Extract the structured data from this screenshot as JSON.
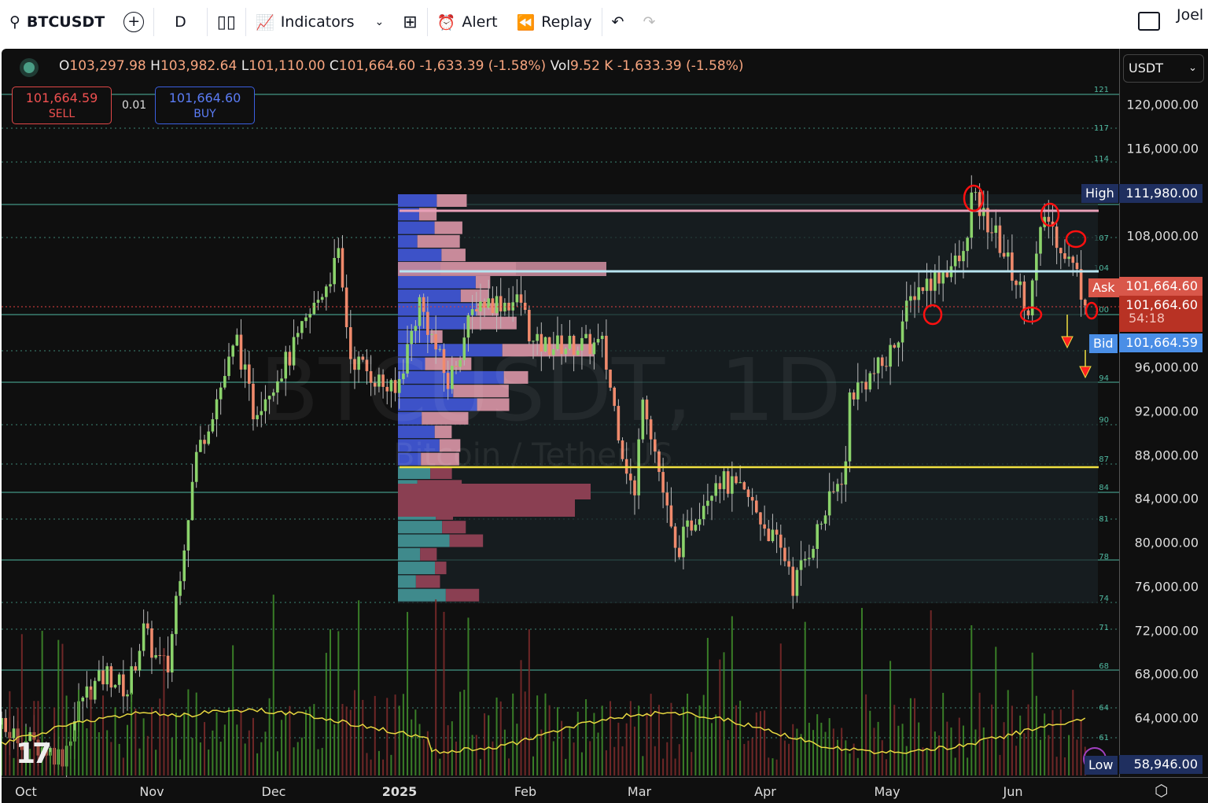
{
  "toolbar": {
    "symbol": "BTCUSDT",
    "interval": "D",
    "indicators": "Indicators",
    "alert": "Alert",
    "replay": "Replay",
    "user": "Joel"
  },
  "legend": {
    "o_label": "O",
    "o": "103,297.98",
    "h_label": "H",
    "h": "103,982.64",
    "l_label": "L",
    "l": "101,110.00",
    "c_label": "C",
    "c": "101,664.60",
    "change": "-1,633.39 (-1.58%)",
    "vol_label": "Vol",
    "vol": "9.52 K",
    "change2": "-1,633.39 (-1.58%)"
  },
  "trade": {
    "sell_price": "101,664.59",
    "sell_label": "SELL",
    "qty": "0.01",
    "buy_price": "101,664.60",
    "buy_label": "BUY"
  },
  "watermark": {
    "title": "BTCUSDT, 1D",
    "subtitle": "Bitcoin / TetherUS"
  },
  "price_axis": {
    "currency": "USDT",
    "labels": [
      "120,000.00",
      "116,000.00",
      "108,000.00",
      "96,000.00",
      "92,000.00",
      "88,000.00",
      "84,000.00",
      "80,000.00",
      "76,000.00",
      "72,000.00",
      "68,000.00",
      "64,000.00"
    ],
    "high_label": "High",
    "high": "111,980.00",
    "ask_label": "Ask",
    "ask": "101,664.60",
    "last": "101,664.60",
    "countdown": "54:18",
    "bid_label": "Bid",
    "bid": "101,664.59",
    "low_label": "Low",
    "low": "58,946.00"
  },
  "level_labels": [
    "121",
    "117",
    "114",
    "107",
    "104",
    "100",
    "94",
    "90",
    "87",
    "84",
    "81",
    "78",
    "74",
    "71",
    "68",
    "64",
    "61"
  ],
  "time_axis": [
    "Oct",
    "Nov",
    "Dec",
    "2025",
    "Feb",
    "Mar",
    "Apr",
    "May",
    "Jun"
  ],
  "colors": {
    "up": "#8bd36b",
    "down": "#f08a6c",
    "ma": "#e8d840",
    "level": "#4fb8a0"
  },
  "chart_data": {
    "type": "candlestick",
    "keypoints_day_price": [
      [
        -6,
        63000
      ],
      [
        0,
        62000
      ],
      [
        9,
        60500
      ],
      [
        14,
        66000
      ],
      [
        20,
        68000
      ],
      [
        25,
        66500
      ],
      [
        29,
        72000
      ],
      [
        32,
        69500
      ],
      [
        35,
        68500
      ],
      [
        37,
        75000
      ],
      [
        42,
        88000
      ],
      [
        44,
        90000
      ],
      [
        52,
        98500
      ],
      [
        56,
        92000
      ],
      [
        65,
        97000
      ],
      [
        77,
        106000
      ],
      [
        80,
        97000
      ],
      [
        91,
        93500
      ],
      [
        97,
        102000
      ],
      [
        104,
        94500
      ],
      [
        111,
        102000
      ],
      [
        122,
        102000
      ],
      [
        125,
        98000
      ],
      [
        142,
        98000
      ],
      [
        147,
        88500
      ],
      [
        150,
        84000
      ],
      [
        152,
        94000
      ],
      [
        160,
        79000
      ],
      [
        170,
        86000
      ],
      [
        178,
        84000
      ],
      [
        188,
        78000
      ],
      [
        189,
        76000
      ],
      [
        202,
        87000
      ],
      [
        203,
        93500
      ],
      [
        212,
        96500
      ],
      [
        219,
        103000
      ],
      [
        231,
        106000
      ],
      [
        233,
        111500
      ],
      [
        239,
        108000
      ],
      [
        247,
        101500
      ],
      [
        251,
        110000
      ],
      [
        259,
        104500
      ],
      [
        261,
        101664
      ]
    ]
  }
}
